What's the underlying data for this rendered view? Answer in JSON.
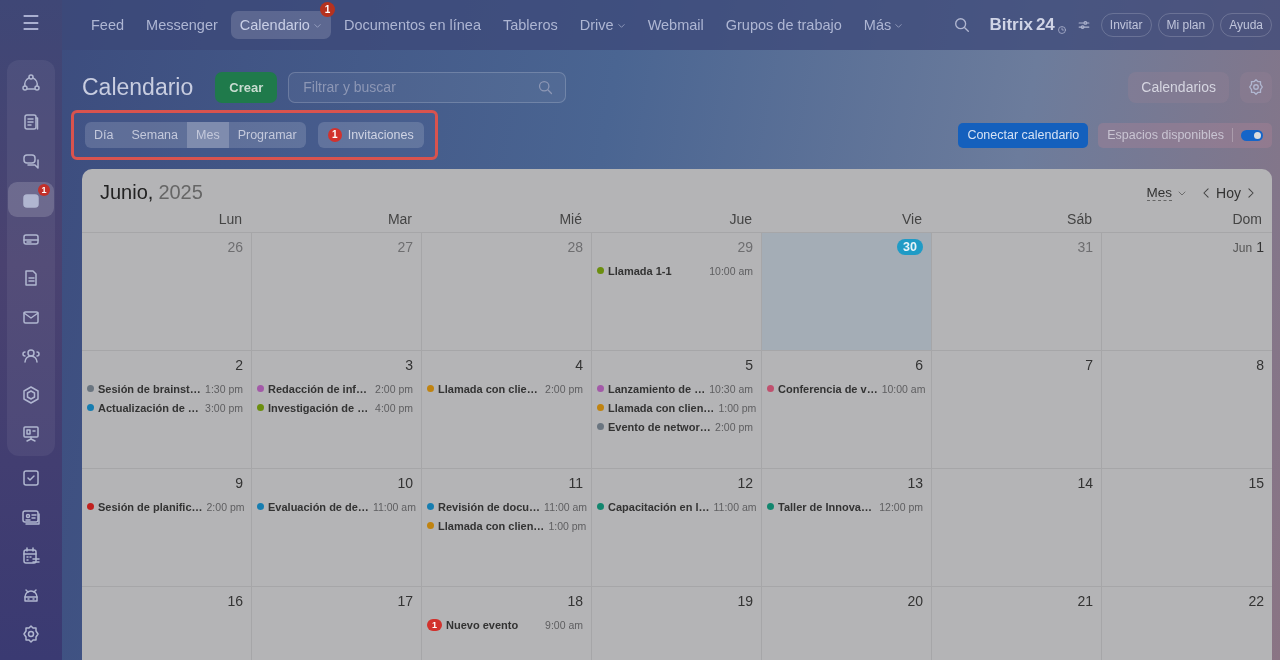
{
  "sidebar": {
    "menu": {
      "label": "☰"
    },
    "panel_items": [
      {
        "selected": false
      },
      {
        "selected": false
      },
      {
        "selected": false
      },
      {
        "selected": true,
        "badge": "1"
      },
      {
        "selected": false
      },
      {
        "selected": false
      },
      {
        "selected": false
      },
      {
        "selected": false
      },
      {
        "selected": false
      },
      {
        "selected": false
      }
    ],
    "items": [
      {
        "selected": false
      },
      {
        "selected": false
      },
      {
        "selected": false
      },
      {
        "selected": false
      },
      {
        "selected": false
      }
    ]
  },
  "topnav": [
    {
      "label": "Feed",
      "selected": false,
      "dropdown": false
    },
    {
      "label": "Messenger",
      "selected": false,
      "dropdown": false
    },
    {
      "label": "Calendario",
      "selected": true,
      "dropdown": true,
      "badge": "1"
    },
    {
      "label": "Documentos en línea",
      "selected": false,
      "dropdown": false
    },
    {
      "label": "Tableros",
      "selected": false,
      "dropdown": false
    },
    {
      "label": "Drive",
      "selected": false,
      "dropdown": true
    },
    {
      "label": "Webmail",
      "selected": false,
      "dropdown": false
    },
    {
      "label": "Grupos de trabajo",
      "selected": false,
      "dropdown": false
    },
    {
      "label": "Más",
      "selected": false,
      "dropdown": true
    }
  ],
  "brand": {
    "name": "Bitrix",
    "number": "24"
  },
  "header_buttons": [
    "Invitar",
    "Mi plan",
    "Ayuda"
  ],
  "toolbar": {
    "title": "Calendario",
    "create": "Crear",
    "search": {
      "placeholder": "Filtrar y buscar"
    },
    "calendars": "Calendarios"
  },
  "view_bar": {
    "highlighted": true,
    "views": [
      {
        "label": "Día",
        "selected": false
      },
      {
        "label": "Semana",
        "selected": false
      },
      {
        "label": "Mes",
        "selected": true
      },
      {
        "label": "Programar",
        "selected": false
      }
    ],
    "invitations": {
      "label": "Invitaciones",
      "badge": "1"
    }
  },
  "connect": "Conectar calendario",
  "slots": {
    "label": "Espacios disponibles",
    "on": true
  },
  "calendar": {
    "month": "Junio,",
    "year": "2025",
    "view_select": "Mes",
    "today_button": "Hoy",
    "weekdays": [
      "Lun",
      "Mar",
      "Mié",
      "Jue",
      "Vie",
      "Sáb",
      "Dom"
    ],
    "weeks": [
      {
        "days": [
          {
            "number": "26",
            "other_month": true,
            "today": false
          },
          {
            "number": "27",
            "other_month": true,
            "today": false
          },
          {
            "number": "28",
            "other_month": true,
            "today": false
          },
          {
            "number": "29",
            "other_month": true,
            "today": false,
            "events": [
              {
                "kind": "dot",
                "title": "Llamada 1-1",
                "time": "10:00 am",
                "color": "#6b8e0e"
              }
            ]
          },
          {
            "number": "30",
            "other_month": true,
            "today": true
          },
          {
            "number": "31",
            "other_month": true,
            "today": false
          },
          {
            "month_label": "Jun",
            "number": "1",
            "other_month": false,
            "today": false
          }
        ]
      },
      {
        "days": [
          {
            "number": "2",
            "other_month": false,
            "today": false,
            "events": [
              {
                "kind": "dot",
                "title": "Sesión de brainst…",
                "time": "1:30 pm",
                "color": "#6a7580"
              },
              {
                "kind": "dot",
                "title": "Actualización de …",
                "time": "3:00 pm",
                "color": "#167db0"
              }
            ]
          },
          {
            "number": "3",
            "other_month": false,
            "today": false,
            "events": [
              {
                "kind": "dot",
                "title": "Redacción de inf…",
                "time": "2:00 pm",
                "color": "#a35aa8"
              },
              {
                "kind": "dot",
                "title": "Investigación de …",
                "time": "4:00 pm",
                "color": "#6b8e0e"
              }
            ]
          },
          {
            "number": "4",
            "other_month": false,
            "today": false,
            "events": [
              {
                "kind": "dot",
                "title": "Llamada con clie…",
                "time": "2:00 pm",
                "color": "#c08310"
              }
            ]
          },
          {
            "number": "5",
            "other_month": false,
            "today": false,
            "events": [
              {
                "kind": "dot",
                "title": "Lanzamiento de …",
                "time": "10:30 am",
                "color": "#a35aa8"
              },
              {
                "kind": "dot",
                "title": "Llamada con clien…",
                "time": "1:00 pm",
                "color": "#c08310"
              },
              {
                "kind": "dot",
                "title": "Evento de networ…",
                "time": "2:00 pm",
                "color": "#6a7580"
              }
            ]
          },
          {
            "number": "6",
            "other_month": false,
            "today": false,
            "events": [
              {
                "kind": "dot",
                "title": "Conferencia de v…",
                "time": "10:00 am",
                "color": "#c0506e"
              }
            ]
          },
          {
            "number": "7",
            "other_month": false,
            "today": false
          },
          {
            "number": "8",
            "other_month": false,
            "today": false
          }
        ]
      },
      {
        "days": [
          {
            "number": "9",
            "other_month": false,
            "today": false,
            "events": [
              {
                "kind": "dot",
                "title": "Sesión de planific…",
                "time": "2:00 pm",
                "color": "#c0201e"
              }
            ]
          },
          {
            "number": "10",
            "other_month": false,
            "today": false,
            "events": [
              {
                "kind": "dot",
                "title": "Evaluación de de…",
                "time": "11:00 am",
                "color": "#167db0"
              }
            ]
          },
          {
            "number": "11",
            "other_month": false,
            "today": false,
            "events": [
              {
                "kind": "dot",
                "title": "Revisión de docu…",
                "time": "11:00 am",
                "color": "#167db0"
              },
              {
                "kind": "dot",
                "title": "Llamada con clien…",
                "time": "1:00 pm",
                "color": "#c08310"
              }
            ]
          },
          {
            "number": "12",
            "other_month": false,
            "today": false,
            "events": [
              {
                "kind": "dot",
                "title": "Capacitación en l…",
                "time": "11:00 am",
                "color": "#12866e"
              }
            ]
          },
          {
            "number": "13",
            "other_month": false,
            "today": false,
            "events": [
              {
                "kind": "dot",
                "title": "Taller de Innova…",
                "time": "12:00 pm",
                "color": "#12866e"
              }
            ]
          },
          {
            "number": "14",
            "other_month": false,
            "today": false
          },
          {
            "number": "15",
            "other_month": false,
            "today": false
          }
        ]
      },
      {
        "days": [
          {
            "number": "16",
            "other_month": false,
            "today": false
          },
          {
            "number": "17",
            "other_month": false,
            "today": false
          },
          {
            "number": "18",
            "other_month": false,
            "today": false,
            "events": [
              {
                "kind": "invite",
                "badge": "1",
                "title": "Nuevo evento",
                "time": "9:00 am"
              }
            ]
          },
          {
            "number": "19",
            "other_month": false,
            "today": false
          },
          {
            "number": "20",
            "other_month": false,
            "today": false
          },
          {
            "number": "21",
            "other_month": false,
            "today": false
          },
          {
            "number": "22",
            "other_month": false,
            "today": false
          }
        ]
      }
    ]
  }
}
